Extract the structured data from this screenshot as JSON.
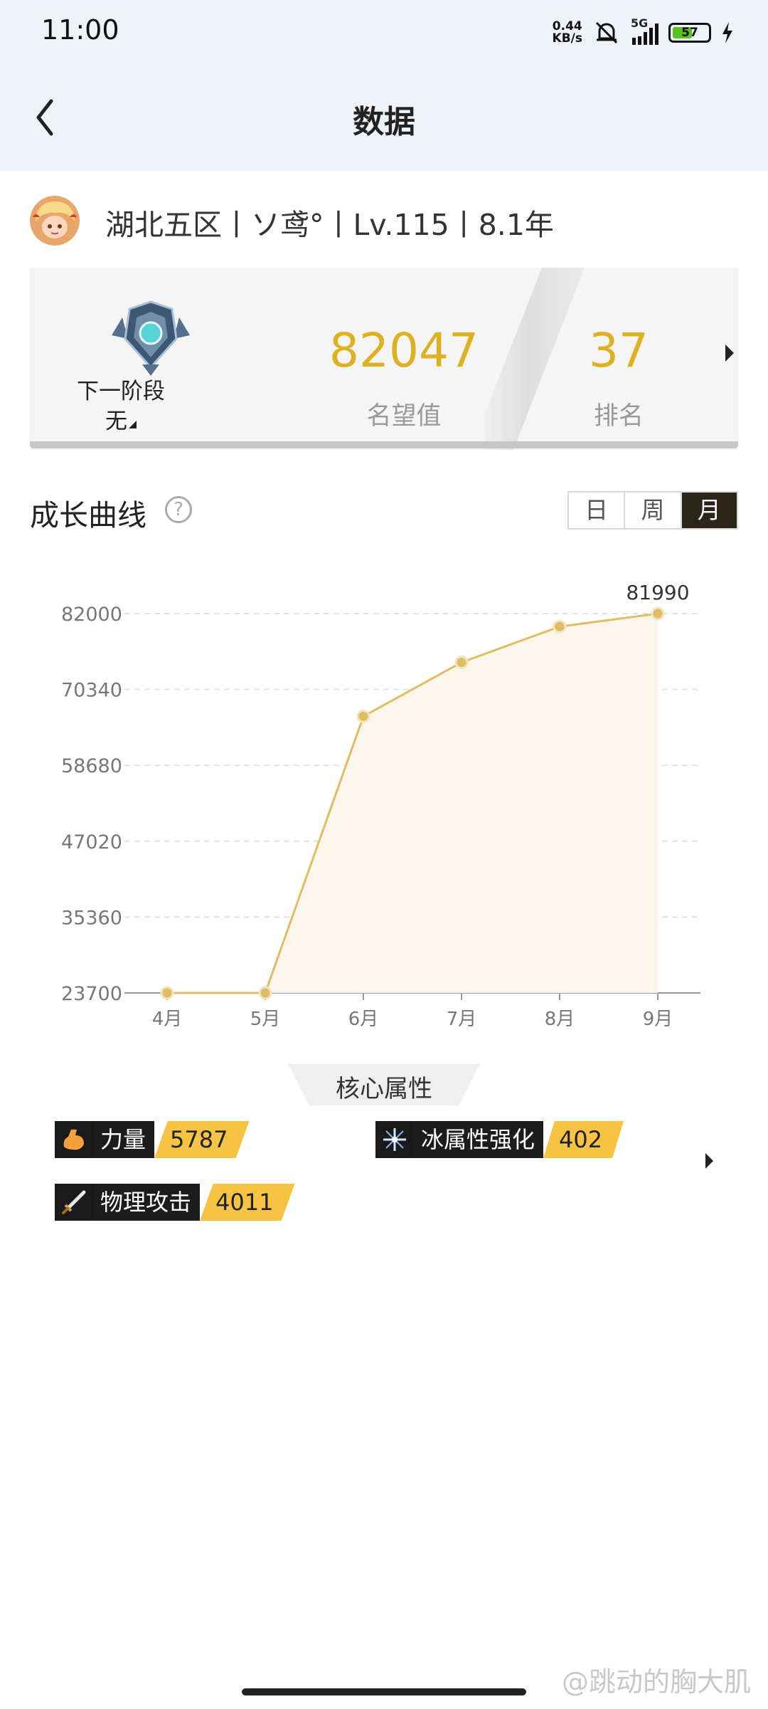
{
  "status_bar": {
    "time": "11:00",
    "net_speed_value": "0.44",
    "net_speed_unit": "KB/s",
    "signal_type": "5G",
    "battery": "57",
    "battery_level_percent": 57,
    "icons": [
      "mute-bell-icon",
      "signal-icon",
      "battery-icon",
      "charging-icon"
    ]
  },
  "nav": {
    "title": "数据",
    "back_icon": "chevron-left-icon"
  },
  "profile": {
    "info": "湖北五区丨ソ鸢°丨Lv.115丨8.1年"
  },
  "rank_card": {
    "next_stage_label": "下一阶段",
    "next_stage_value": "无",
    "reputation_value": "82047",
    "reputation_label": "名望值",
    "rank_value": "37",
    "rank_label": "排名"
  },
  "growth": {
    "title": "成长曲线",
    "help_icon": "?",
    "periods": [
      "日",
      "周",
      "月"
    ],
    "active_period": "月"
  },
  "chart_data": {
    "type": "area",
    "categories": [
      "4月",
      "5月",
      "6月",
      "7月",
      "8月",
      "9月"
    ],
    "values": [
      23700,
      23700,
      66200,
      74500,
      80000,
      81990
    ],
    "y_ticks": [
      "82000",
      "70340",
      "58680",
      "47020",
      "35360",
      "23700"
    ],
    "ylim": [
      23700,
      82000
    ],
    "annotation": "81990",
    "grid": "horizontal dashed",
    "colors": {
      "line": "#e0bc62",
      "fill": "#fbf6ec",
      "point": "#e0bc62"
    }
  },
  "core_attributes": {
    "title": "核心属性",
    "items": [
      {
        "name": "力量",
        "value": "5787",
        "icon": "flexed-arm-icon"
      },
      {
        "name": "冰属性强化",
        "value": "402",
        "icon": "ice-crystal-icon"
      },
      {
        "name": "物理攻击",
        "value": "4011",
        "icon": "sword-icon"
      }
    ]
  },
  "watermark": "@跳动的胸大肌",
  "colors": {
    "accent_gold": "#deb120",
    "value_tag": "#f7c343",
    "nav_bg": "#eff2f7"
  }
}
